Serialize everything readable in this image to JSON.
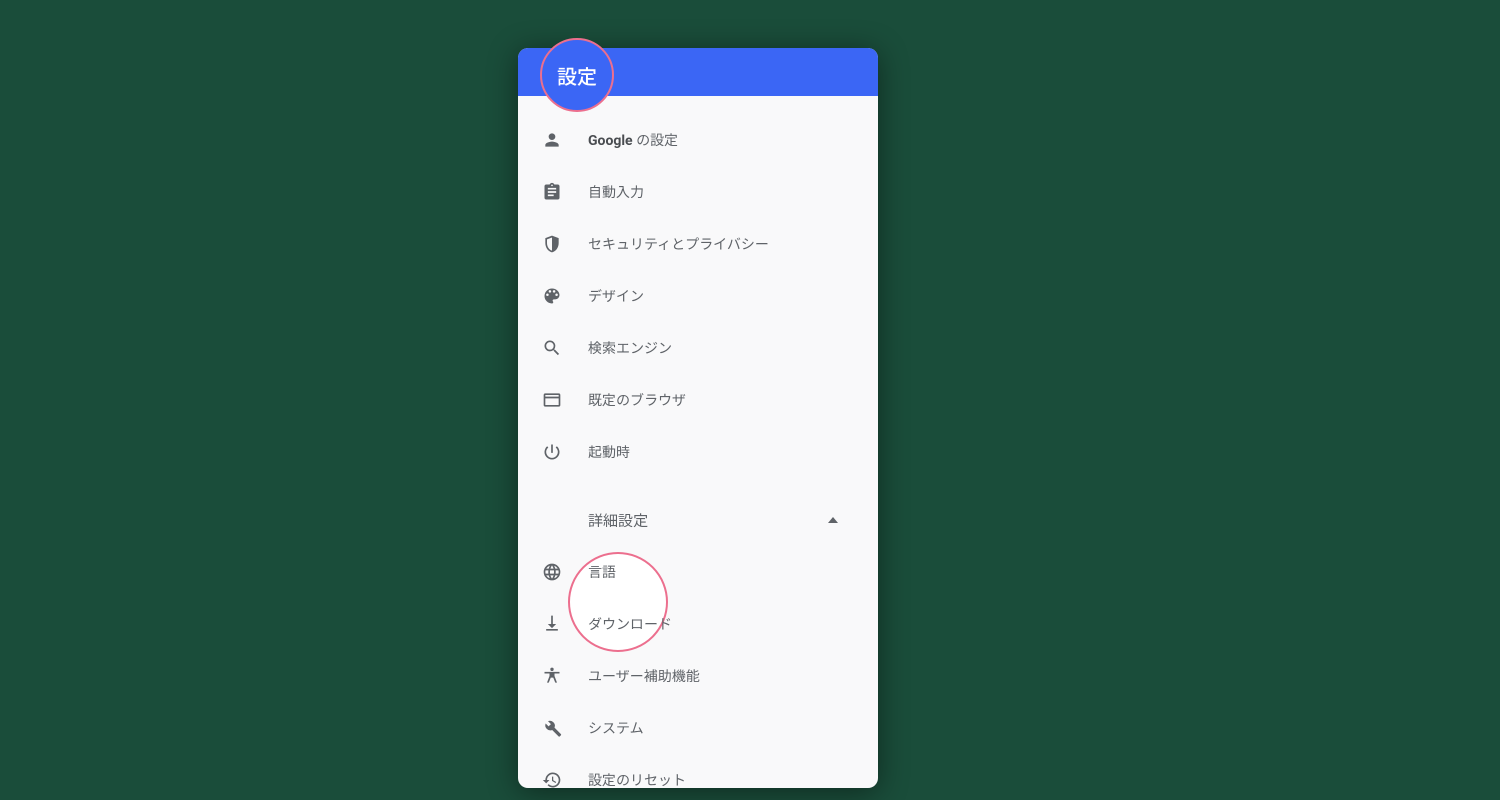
{
  "header": {
    "title": "設定"
  },
  "callouts": {
    "title_circle": "設定",
    "advanced_circle_target": "詳細設定"
  },
  "menu": {
    "items": [
      {
        "icon": "person-icon",
        "label_html": "<strong>Google</strong> の設定",
        "label_plain": "Google の設定"
      },
      {
        "icon": "clipboard-icon",
        "label": "自動入力"
      },
      {
        "icon": "shield-icon",
        "label": "セキュリティとプライバシー"
      },
      {
        "icon": "palette-icon",
        "label": "デザイン"
      },
      {
        "icon": "search-icon",
        "label": "検索エンジン"
      },
      {
        "icon": "browser-icon",
        "label": "既定のブラウザ"
      },
      {
        "icon": "power-icon",
        "label": "起動時"
      }
    ],
    "advanced_section": {
      "label": "詳細設定",
      "expanded": true,
      "items": [
        {
          "icon": "globe-icon",
          "label": "言語"
        },
        {
          "icon": "download-icon",
          "label": "ダウンロード"
        },
        {
          "icon": "accessibility-icon",
          "label": "ユーザー補助機能"
        },
        {
          "icon": "wrench-icon",
          "label": "システム"
        },
        {
          "icon": "restore-icon",
          "label": "設定のリセット"
        }
      ]
    }
  },
  "colors": {
    "accent": "#3b66f5",
    "callout_ring": "#ec6f8e",
    "icon": "#5f6368",
    "panel_bg": "#f9f9fa",
    "page_bg": "#1a4d3a"
  }
}
